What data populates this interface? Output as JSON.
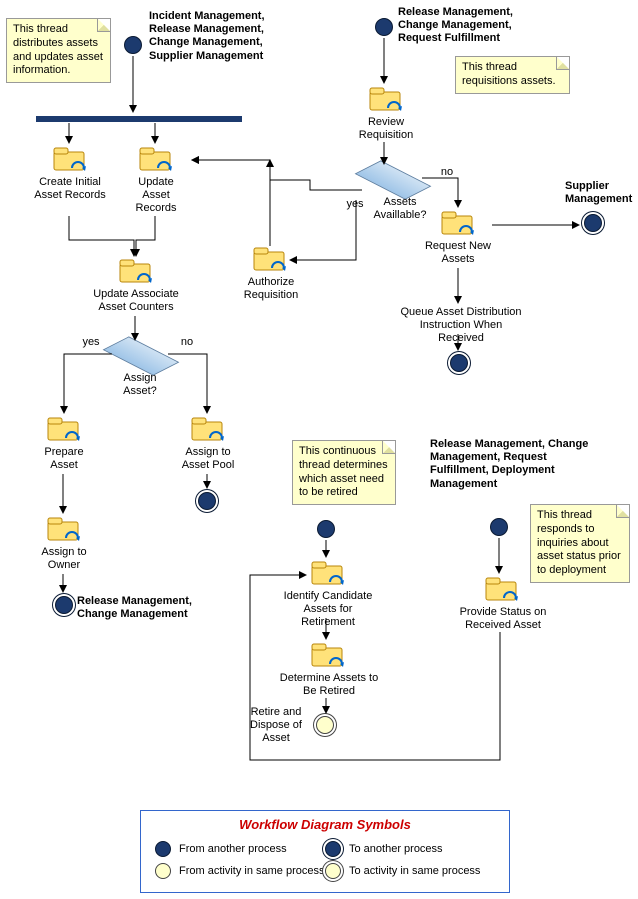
{
  "notes": {
    "n1": "This thread distributes assets and updates asset information.",
    "n2": "This thread requisitions assets.",
    "n3": "This continuous thread determines which asset need to be retired",
    "n4": "This thread responds to inquiries about asset status prior to deployment"
  },
  "titles": {
    "t1": "Incident Management, Release Management, Change Management, Supplier Management",
    "t2": "Release Management, Change Management, Request Fulfillment",
    "t3": "Supplier Management",
    "t4": "Release Management, Change Management",
    "t5": "Release Management, Change Management, Request Fulfillment, Deployment Management"
  },
  "tasks": {
    "create_initial": "Create Initial Asset Records",
    "update_records": "Update Asset Records",
    "update_counters": "Update Associate Asset Counters",
    "prepare_asset": "Prepare Asset",
    "assign_pool": "Assign to Asset Pool",
    "assign_owner": "Assign to Owner",
    "review_req": "Review Requisition",
    "authorize_req": "Authorize Requisition",
    "request_new": "Request New Assets",
    "queue_dist": "Queue Asset Distribution Instruction When Received",
    "identify_cand": "Identify Candidate Assets for Retirement",
    "determine_ret": "Determine Assets to Be Retired",
    "retire_dispose": "Retire and Dispose of Asset",
    "provide_status": "Provide Status on Received Asset"
  },
  "decisions": {
    "assign_asset": "Assign Asset?",
    "assets_avail": "Assets Availlable?",
    "yes": "yes",
    "no": "no"
  },
  "legend": {
    "title": "Workflow Diagram Symbols",
    "from_proc": "From another process",
    "to_proc": "To another process",
    "from_act": "From activity in same process",
    "to_act": "To activity in same process"
  }
}
